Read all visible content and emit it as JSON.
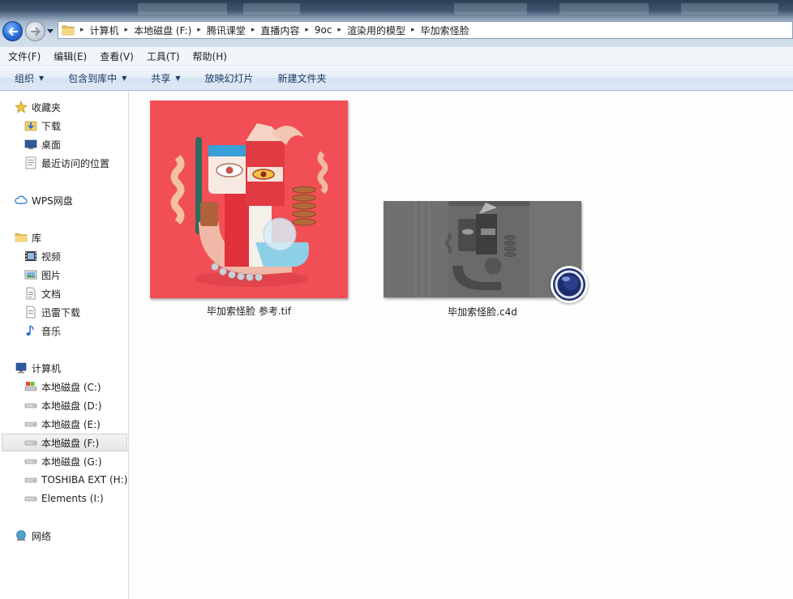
{
  "address_bar": {
    "breadcrumbs": [
      "计算机",
      "本地磁盘 (F:)",
      "腾讯课堂",
      "直播内容",
      "9oc",
      "渲染用的模型",
      "毕加索怪脸"
    ],
    "separator": "▸"
  },
  "menu": [
    "文件(F)",
    "编辑(E)",
    "查看(V)",
    "工具(T)",
    "帮助(H)"
  ],
  "toolbar": {
    "organize": "组织",
    "include_in_library": "包含到库中",
    "share": "共享",
    "slideshow": "放映幻灯片",
    "new_folder": "新建文件夹",
    "caret": "▼"
  },
  "sidebar": {
    "favorites": {
      "label": "收藏夹",
      "items": [
        "下载",
        "桌面",
        "最近访问的位置"
      ]
    },
    "wps": {
      "label": "WPS网盘"
    },
    "libraries": {
      "label": "库",
      "items": [
        "视频",
        "图片",
        "文档",
        "迅雷下载",
        "音乐"
      ]
    },
    "computer": {
      "label": "计算机",
      "items": [
        "本地磁盘 (C:)",
        "本地磁盘 (D:)",
        "本地磁盘 (E:)",
        "本地磁盘 (F:)",
        "本地磁盘 (G:)",
        "TOSHIBA EXT (H:)",
        "Elements (I:)"
      ],
      "selected": "本地磁盘 (F:)"
    },
    "network": {
      "label": "网络"
    }
  },
  "files": [
    {
      "name": "毕加索怪脸 参考.tif",
      "icon": "tif-image-thumbnail"
    },
    {
      "name": "毕加索怪脸.c4d",
      "icon": "cinema4d-logo-icon"
    }
  ],
  "colors": {
    "thumb_red_bg": "#f14f55",
    "c4d_viewport": "#6d6d6d",
    "nav_blue": "#2a6ed8"
  }
}
